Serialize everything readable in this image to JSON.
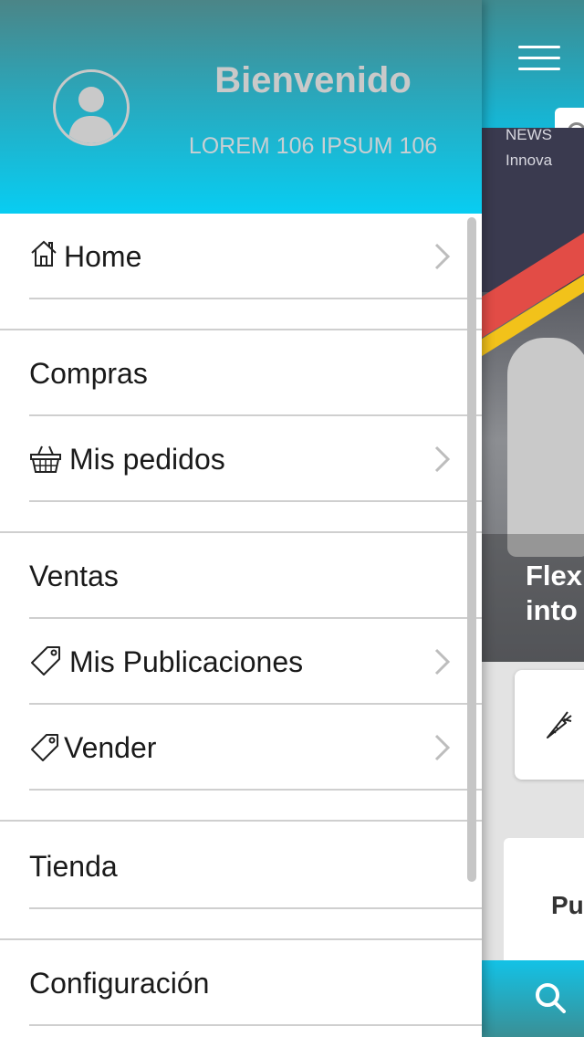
{
  "drawer": {
    "welcome": "Bienvenido",
    "user_subtitle": "LOREM 106 IPSUM 106",
    "items": {
      "home": {
        "label": "Home",
        "icon": "house-icon"
      },
      "compras_header": {
        "label": "Compras"
      },
      "mis_pedidos": {
        "label": "Mis pedidos",
        "icon": "basket-icon"
      },
      "ventas_header": {
        "label": "Ventas"
      },
      "mis_publicaciones": {
        "label": "Mis Publicaciones",
        "icon": "tag-icon"
      },
      "vender": {
        "label": "Vender",
        "icon": "tag-icon"
      },
      "tienda": {
        "label": "Tienda"
      },
      "configuracion": {
        "label": "Configuración"
      }
    }
  },
  "background": {
    "hero_news": "NEWS",
    "hero_news_sub": "Innova",
    "hero_title_line1": "Flexi",
    "hero_title_line2": "into",
    "card_title": "Pu"
  },
  "colors": {
    "accent": "#08cdf2",
    "header_top": "#4b8587"
  }
}
